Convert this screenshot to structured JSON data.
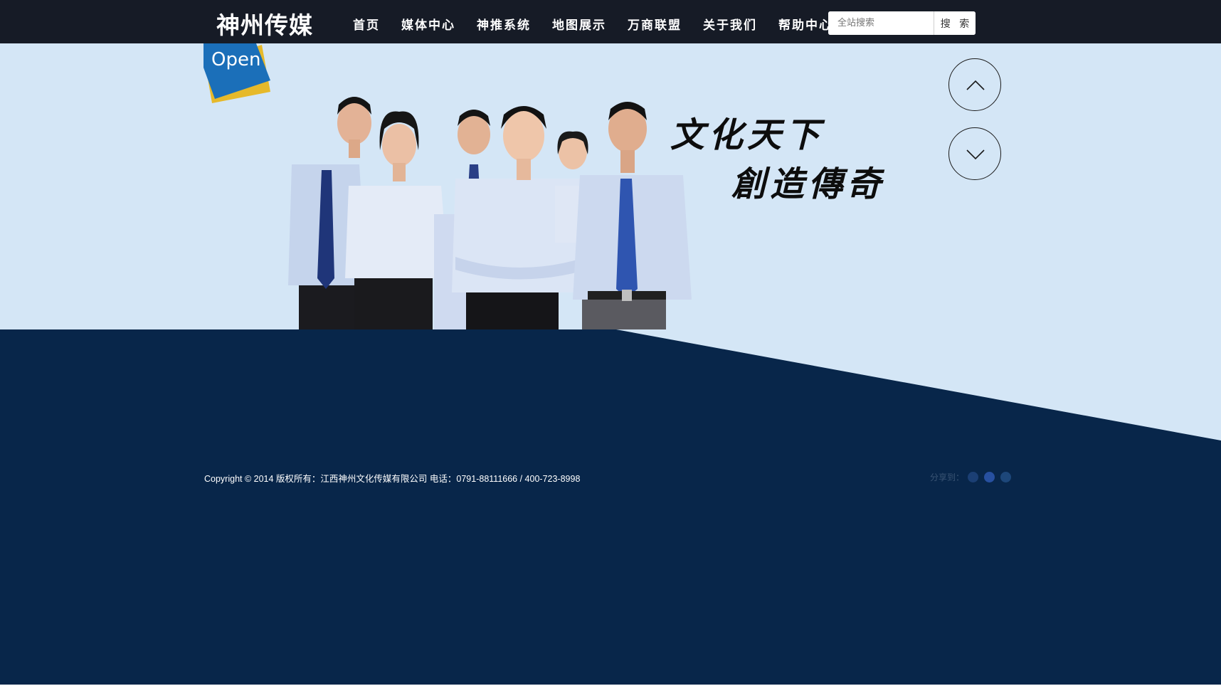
{
  "header": {
    "logo_text": "神州传媒",
    "nav": [
      {
        "label": "首页"
      },
      {
        "label": "媒体中心"
      },
      {
        "label": "神推系统"
      },
      {
        "label": "地图展示"
      },
      {
        "label": "万商联盟"
      },
      {
        "label": "关于我们"
      },
      {
        "label": "帮助中心"
      }
    ],
    "search": {
      "placeholder": "全站搜索",
      "value": "",
      "button_label": "搜 索"
    }
  },
  "hero": {
    "open_tag_label": "Open",
    "slogan_line1": "文化天下",
    "slogan_line2": "創造傳奇",
    "arrow_up_icon": "chevron-up-icon",
    "arrow_down_icon": "chevron-down-icon"
  },
  "footer": {
    "copyright": "Copyright © 2014 版权所有：江西神州文化传媒有限公司 电话：0791-88111666 / 400-723-8998",
    "share_label": "分享到：",
    "share_icons": [
      "share-icon-1",
      "share-icon-2",
      "share-icon-3"
    ]
  },
  "colors": {
    "topbar_bg": "#161b26",
    "hero_bg": "#d4e6f6",
    "footer_bg": "#08264a",
    "open_tag_blue": "#1b6fb9",
    "open_tag_yellow": "#e6b92a"
  }
}
